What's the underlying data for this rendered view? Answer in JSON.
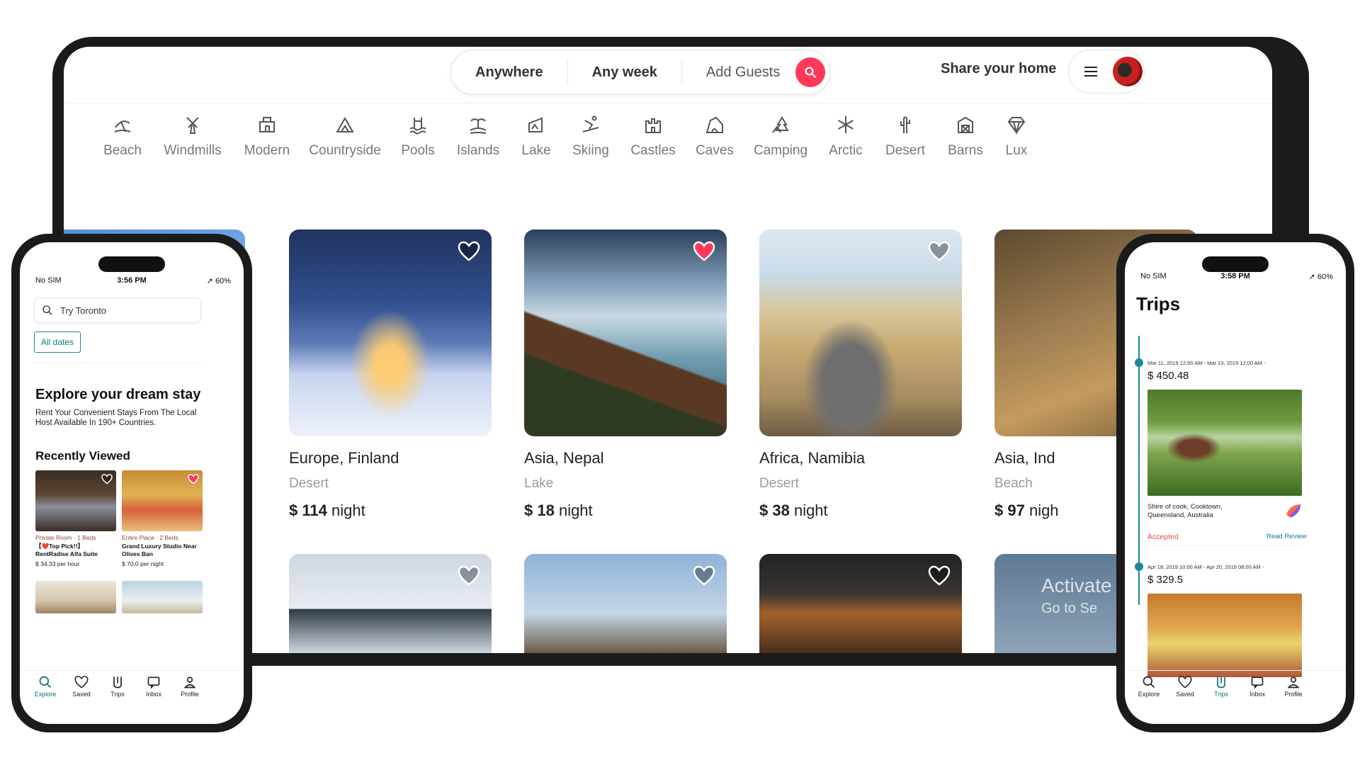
{
  "laptop": {
    "search": {
      "where": "Anywhere",
      "when": "Any week",
      "guests": "Add Guests"
    },
    "header": {
      "share_home": "Share your home"
    },
    "categories": [
      {
        "label": "Beach",
        "icon": "beach-icon"
      },
      {
        "label": "Windmills",
        "icon": "windmill-icon"
      },
      {
        "label": "Modern",
        "icon": "modern-house-icon"
      },
      {
        "label": "Countryside",
        "icon": "countryside-icon"
      },
      {
        "label": "Pools",
        "icon": "pool-icon"
      },
      {
        "label": "Islands",
        "icon": "island-icon"
      },
      {
        "label": "Lake",
        "icon": "lake-icon"
      },
      {
        "label": "Skiing",
        "icon": "skiing-icon"
      },
      {
        "label": "Castles",
        "icon": "castle-icon"
      },
      {
        "label": "Caves",
        "icon": "cave-icon"
      },
      {
        "label": "Camping",
        "icon": "camping-icon"
      },
      {
        "label": "Arctic",
        "icon": "snowflake-icon"
      },
      {
        "label": "Desert",
        "icon": "cactus-icon"
      },
      {
        "label": "Barns",
        "icon": "barn-icon"
      },
      {
        "label": "Lux",
        "icon": "diamond-icon"
      }
    ],
    "listings": [
      {
        "title": "Europe, Finland",
        "category": "Desert",
        "price": "$ 114",
        "unit": "night",
        "favorited": false
      },
      {
        "title": "Asia, Nepal",
        "category": "Lake",
        "price": "$ 18",
        "unit": "night",
        "favorited": true
      },
      {
        "title": "Africa, Namibia",
        "category": "Desert",
        "price": "$ 38",
        "unit": "night",
        "favorited": false
      },
      {
        "title": "Asia, Ind",
        "category": "Beach",
        "price": "$ 97",
        "unit": "nigh",
        "favorited": false
      }
    ],
    "watermark": {
      "line1": "Activate",
      "line2": "Go to Se"
    }
  },
  "phone_left": {
    "status": {
      "carrier": "No SIM",
      "time": "3:56 PM",
      "battery": "60%"
    },
    "search_placeholder": "Try Toronto",
    "dates_button": "All dates",
    "heading": "Explore your dream stay",
    "subheading": "Rent Your Convenient Stays From The Local Host Available In 190+ Countries.",
    "recent_heading": "Recently Viewed",
    "recent": [
      {
        "type": "Private Room · 1 Beds",
        "title": "【❤️Top Pick!!】RentRadise Alfa Suite",
        "price": "$ 34.33 per hour",
        "favorited": false
      },
      {
        "type": "Entire Place · 2 Beds",
        "title": "Grand Luxury Studio Near Olives Ban",
        "price": "$ 70.0 per night",
        "favorited": true
      }
    ],
    "tabs": [
      {
        "label": "Explore",
        "icon": "search-icon"
      },
      {
        "label": "Saved",
        "icon": "heart-icon"
      },
      {
        "label": "Trips",
        "icon": "trips-icon"
      },
      {
        "label": "Inbox",
        "icon": "inbox-icon"
      },
      {
        "label": "Profile",
        "icon": "profile-icon"
      }
    ]
  },
  "phone_right": {
    "status": {
      "carrier": "No SIM",
      "time": "3:58 PM",
      "battery": "60%"
    },
    "title": "Trips",
    "trips": [
      {
        "dates": "Mar 11, 2019 12:00 AM - Mar 13, 2019 12:00 AM -",
        "price": "$ 450.48",
        "location": "Shire of cook, Cooktown, Queensland, Australia",
        "status": "Accepted",
        "action": "Read Review"
      },
      {
        "dates": "Apr 18, 2019 10:00 AM - Apr 20, 2019 08:00 AM -",
        "price": "$ 329.5"
      }
    ],
    "tabs": [
      {
        "label": "Explore",
        "icon": "search-icon"
      },
      {
        "label": "Saved",
        "icon": "heart-icon"
      },
      {
        "label": "Trips",
        "icon": "trips-icon"
      },
      {
        "label": "Inbox",
        "icon": "inbox-icon"
      },
      {
        "label": "Profile",
        "icon": "profile-icon"
      }
    ]
  },
  "colors": {
    "brand": "#ff385c",
    "teal": "#1a8b95",
    "accepted": "#e5484d"
  }
}
